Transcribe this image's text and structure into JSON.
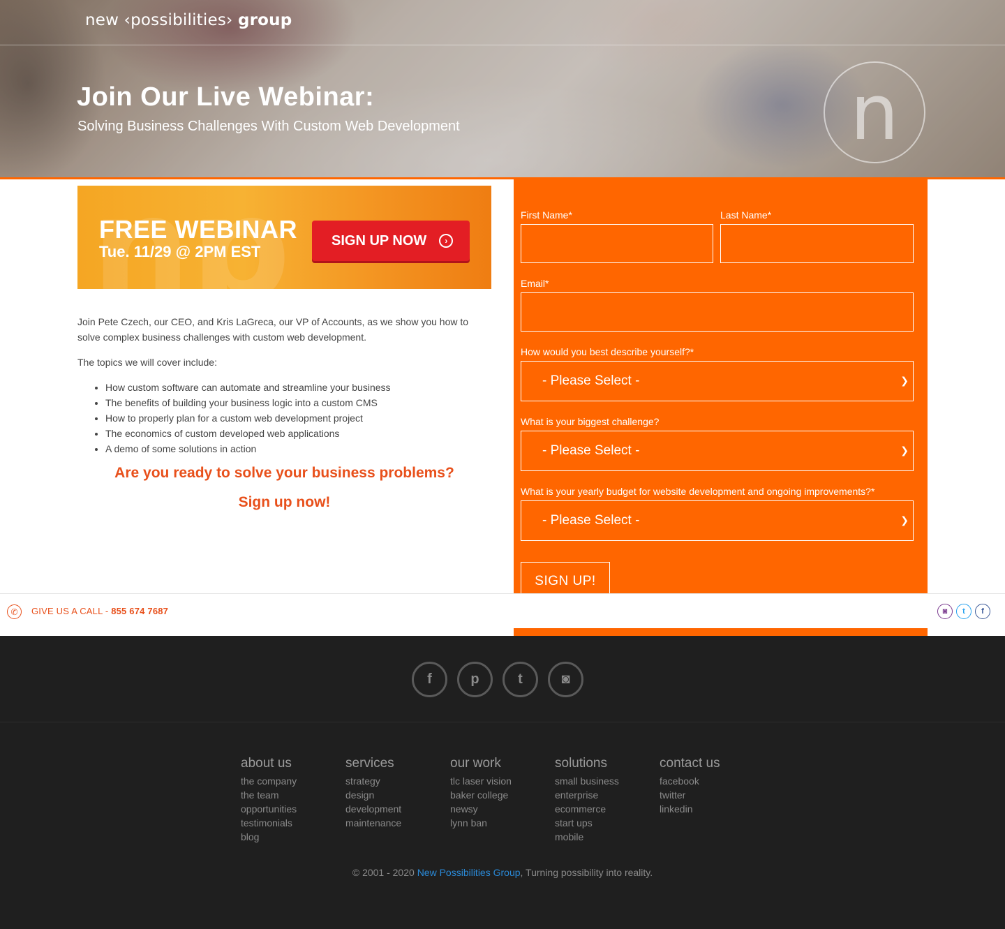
{
  "header": {
    "logo_left": "new",
    "logo_middle": "possibilities",
    "logo_right": "group",
    "title": "Join Our Live Webinar:",
    "subtitle": "Solving Business Challenges With Custom Web Development",
    "circle_letter": "n"
  },
  "banner": {
    "title": "FREE WEBINAR",
    "date": "Tue. 11/29 @ 2PM EST",
    "button_label": "SIGN UP NOW",
    "button_icon": "chevron-right-circle-icon"
  },
  "content": {
    "intro": "Join Pete Czech, our CEO, and Kris LaGreca, our VP of Accounts, as we show you how to solve complex business challenges with custom web development.",
    "topics_intro": "The topics we will cover include:",
    "topics": [
      "How custom software can automate and streamline your business",
      "The benefits of building your business logic into a custom CMS",
      "How to properly plan for a custom web development project",
      "The economics of custom developed web applications",
      "A demo of some solutions in action"
    ],
    "cta_question": "Are you ready to solve your business problems?",
    "cta_action": "Sign up now!"
  },
  "form": {
    "first_name_label": "First Name*",
    "first_name_value": "",
    "last_name_label": "Last Name*",
    "last_name_value": "",
    "email_label": "Email*",
    "email_value": "",
    "describe_label": "How would you best describe yourself?*",
    "describe_value": "- Please Select -",
    "challenge_label": "What is your biggest challenge?",
    "challenge_value": "- Please Select -",
    "budget_label": "What is your yearly budget for website development and ongoing improvements?*",
    "budget_value": "- Please Select -",
    "submit_label": "SIGN UP!",
    "panel_color": "#ff6600"
  },
  "callbar": {
    "text": "GIVE US A CALL - ",
    "phone": "855 674 7687",
    "icons": [
      "instagram-icon",
      "twitter-icon",
      "facebook-icon"
    ]
  },
  "footer": {
    "social": [
      "facebook-icon",
      "pinterest-icon",
      "twitter-icon",
      "instagram-icon"
    ],
    "columns": [
      {
        "heading": "about us",
        "links": [
          "the company",
          "the team",
          "opportunities",
          "testimonials",
          "blog"
        ]
      },
      {
        "heading": "services",
        "links": [
          "strategy",
          "design",
          "development",
          "maintenance"
        ]
      },
      {
        "heading": "our work",
        "links": [
          "tlc laser vision",
          "baker college",
          "newsy",
          "lynn ban"
        ]
      },
      {
        "heading": "solutions",
        "links": [
          "small business",
          "enterprise",
          "ecommerce",
          "start ups",
          "mobile"
        ]
      },
      {
        "heading": "contact us",
        "links": [
          "facebook",
          "twitter",
          "linkedin"
        ]
      }
    ],
    "copyright_prefix": "© 2001 - 2020 ",
    "copyright_link": "New Possibilities Group",
    "copyright_suffix": ", Turning possibility into reality."
  },
  "colors": {
    "accent": "#ff6600",
    "cta": "#e8501b",
    "footer_bg": "#1f1f1f",
    "link": "#2a8ad8"
  }
}
